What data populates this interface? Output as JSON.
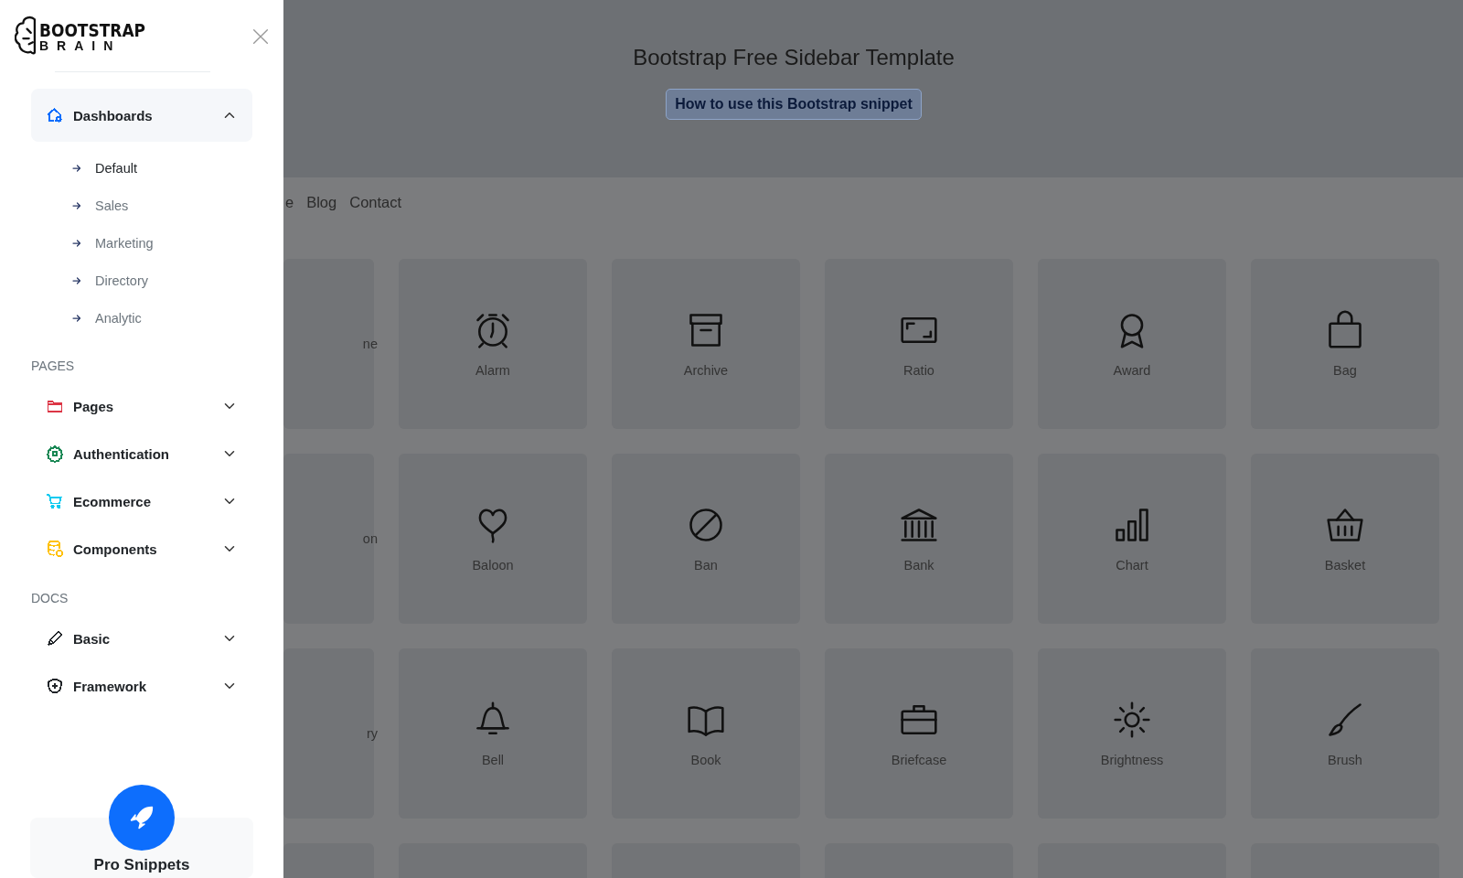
{
  "sidebar": {
    "logo": {
      "line1": "BOOTSTRAP",
      "line2": "BRAIN"
    },
    "menu": [
      {
        "label": "Dashboards",
        "color": "#0d6efd",
        "expanded": true,
        "children": [
          {
            "label": "Default",
            "selected": true
          },
          {
            "label": "Sales",
            "selected": false
          },
          {
            "label": "Marketing",
            "selected": false
          },
          {
            "label": "Directory",
            "selected": false
          },
          {
            "label": "Analytic",
            "selected": false
          }
        ]
      }
    ],
    "sections": [
      {
        "heading": "PAGES",
        "items": [
          {
            "label": "Pages",
            "color": "#dc3545",
            "expanded": false
          },
          {
            "label": "Authentication",
            "color": "#198754",
            "expanded": false
          },
          {
            "label": "Ecommerce",
            "color": "#0dcaf0",
            "expanded": false
          },
          {
            "label": "Components",
            "color": "#ffc107",
            "expanded": false
          }
        ]
      },
      {
        "heading": "DOCS",
        "items": [
          {
            "label": "Basic",
            "color": "#212529",
            "expanded": false
          },
          {
            "label": "Framework",
            "color": "#212529",
            "expanded": false
          }
        ]
      }
    ],
    "promo": {
      "title": "Pro Snippets"
    }
  },
  "header": {
    "title": "Bootstrap Free Sidebar Template",
    "button": "How to use this Bootstrap snippet"
  },
  "nav": [
    "e",
    "Blog",
    "Contact"
  ],
  "grid": {
    "rows": [
      [
        "ne",
        "Alarm",
        "Archive",
        "Ratio",
        "Award",
        "Bag"
      ],
      [
        "on",
        "Baloon",
        "Ban",
        "Bank",
        "Chart",
        "Basket"
      ],
      [
        "ry",
        "Bell",
        "Book",
        "Briefcase",
        "Brightness",
        "Brush"
      ]
    ]
  }
}
